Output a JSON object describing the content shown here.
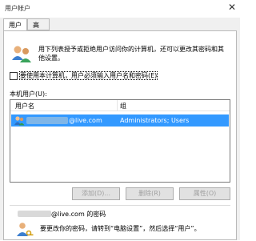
{
  "window": {
    "title": "用户帐户",
    "close_glyph": "✕"
  },
  "tabs": [
    {
      "label": "用户",
      "active": true
    },
    {
      "label": "高级",
      "active": false
    }
  ],
  "intro_text": "用下列表授予或拒绝用户访问你的计算机，还可以更改其密码和其他设置。",
  "require_password": {
    "label": "要使用本计算机，用户必须输入用户名和密码(E)",
    "checked": false
  },
  "users_list": {
    "label": "本机用户(U):",
    "columns": [
      "用户名",
      "组"
    ],
    "rows": [
      {
        "username_suffix": "@live.com",
        "group": "Administrators; Users",
        "selected": true
      }
    ]
  },
  "buttons": {
    "add": "添加(D)...",
    "remove": "删除(R)",
    "properties": "属性(O)"
  },
  "password_section": {
    "title_suffix": "@live.com 的密码",
    "text": "要更改你的密码，请转到“电脑设置”，然后选择“用户”。"
  },
  "colors": {
    "selection": "#3399ff",
    "window_bg": "#f0f0f0",
    "panel_bg": "#ffffff"
  }
}
